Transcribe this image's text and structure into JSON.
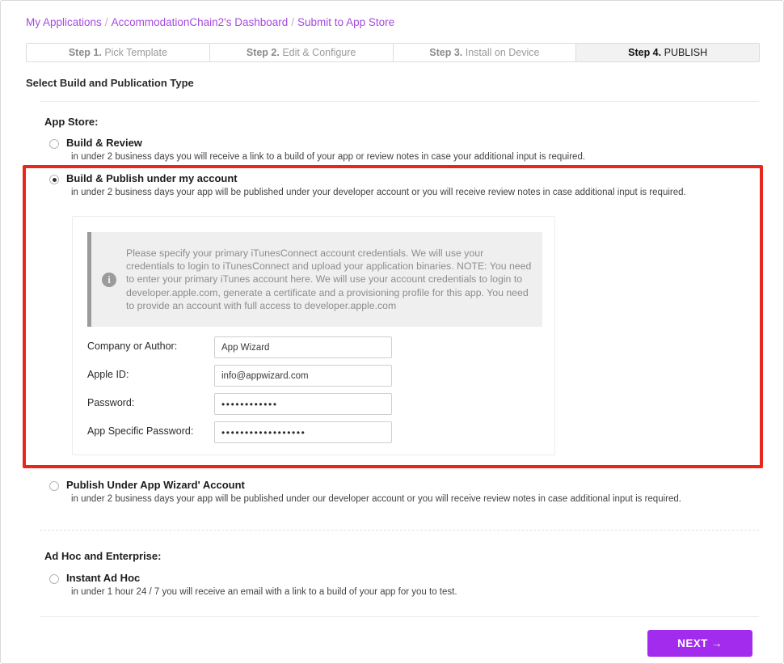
{
  "breadcrumb": {
    "items": [
      {
        "label": "My Applications"
      },
      {
        "label": "AccommodationChain2's Dashboard"
      },
      {
        "label": "Submit to App Store"
      }
    ],
    "separator": "/"
  },
  "steps": [
    {
      "num": "Step 1.",
      "label": "Pick Template",
      "active": false
    },
    {
      "num": "Step 2.",
      "label": "Edit & Configure",
      "active": false
    },
    {
      "num": "Step 3.",
      "label": "Install on Device",
      "active": false
    },
    {
      "num": "Step 4.",
      "label": "PUBLISH",
      "active": true
    }
  ],
  "page_title": "Select Build and Publication Type",
  "groups": {
    "app_store_title": "App Store:",
    "ad_hoc_title": "Ad Hoc and Enterprise:"
  },
  "options": {
    "build_review": {
      "title": "Build & Review",
      "desc": "in under 2 business days you will receive a link to a build of your app or review notes in case your additional input is required.",
      "selected": false
    },
    "build_publish_my_account": {
      "title": "Build & Publish under my account",
      "desc": "in under 2 business days your app will be published under your developer account or you will receive review notes in case additional input is required.",
      "selected": true
    },
    "publish_under_app_wizard": {
      "title": "Publish Under App Wizard' Account",
      "desc": "in under 2 business days your app will be published under our developer account or you will receive review notes in case additional input is required.",
      "selected": false
    },
    "instant_ad_hoc": {
      "title": "Instant Ad Hoc",
      "desc": "in under 1 hour 24 / 7 you will receive an email with a link to a build of your app for you to test.",
      "selected": false
    }
  },
  "credentials": {
    "info_icon": "info-icon",
    "info_text": "Please specify your primary iTunesConnect account credentials. We will use your credentials to login to iTunesConnect and upload your application binaries. NOTE: You need to enter your primary iTunes account here. We will use your account credentials to login to developer.apple.com, generate a certificate and a provisioning profile for this app. You need to provide an account with full access to developer.apple.com",
    "fields": [
      {
        "label": "Company or Author:",
        "value": "App Wizard",
        "masked": false
      },
      {
        "label": "Apple ID:",
        "value": "info@appwizard.com",
        "masked": false
      },
      {
        "label": "Password:",
        "value": "••••••••••••",
        "masked": true
      },
      {
        "label": "App Specific Password:",
        "value": "••••••••••••••••••",
        "masked": true
      }
    ]
  },
  "footer": {
    "next_label": "NEXT →"
  },
  "colors": {
    "accent": "#a22bee",
    "link": "#a64ae0",
    "highlight_border": "#e8271a",
    "info_bg": "#efefef"
  }
}
